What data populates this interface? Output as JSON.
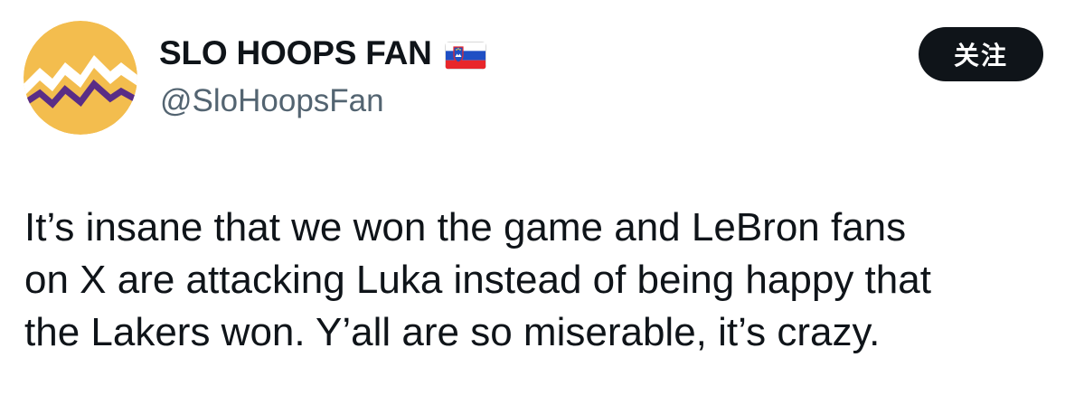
{
  "author": {
    "display_name": "SLO HOOPS FAN",
    "handle": "@SloHoopsFan",
    "flag_icon": "slovenia-flag-icon",
    "avatar_colors": {
      "background": "#f3bd4e",
      "peaks": "#ffffff",
      "stripe": "#5a2d86"
    }
  },
  "follow_button": {
    "label": "关注"
  },
  "tweet": {
    "lines": [
      "It’s insane that we won the game and LeBron fans",
      "on X are attacking Luka instead of being happy that",
      "the Lakers won. Y’all are so miserable, it’s crazy."
    ]
  },
  "colors": {
    "text_primary": "#0f1419",
    "text_secondary": "#536471",
    "button_bg": "#0f1419",
    "button_text": "#ffffff"
  }
}
